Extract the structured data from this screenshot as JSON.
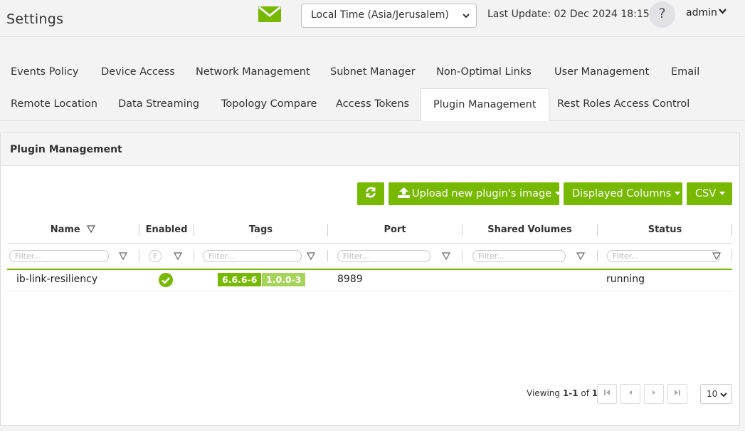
{
  "header": {
    "title": "Settings",
    "timezone_select": "Local Time (Asia/Jerusalem)",
    "last_update": "Last Update: 02 Dec 2024 18:15",
    "help_label": "?",
    "user": "admin",
    "icons": [
      "mail-icon",
      "chevron-down-icon",
      "help-icon"
    ]
  },
  "tabs": {
    "row1": [
      "Events Policy",
      "Device Access",
      "Network Management",
      "Subnet Manager",
      "Non-Optimal Links",
      "User Management",
      "Email"
    ],
    "row2": [
      "Remote Location",
      "Data Streaming",
      "Topology Compare",
      "Access Tokens",
      "Plugin Management",
      "Rest Roles Access Control"
    ],
    "active": "Plugin Management"
  },
  "panel": {
    "title": "Plugin Management",
    "toolbar": {
      "upload_label": "Upload new plugin's image",
      "columns_label": "Displayed Columns",
      "csv_label": "CSV"
    },
    "columns": [
      "Name",
      "Enabled",
      "Tags",
      "Port",
      "Shared Volumes",
      "Status"
    ],
    "filter_placeholder": "Filter...",
    "enabled_filter_placeholder": "F",
    "rows": [
      {
        "name": "ib-link-resiliency",
        "enabled": true,
        "tags": [
          "6.6.6-6",
          "1.0.0-3"
        ],
        "port": "8989",
        "shared_volumes": "",
        "status": "running"
      }
    ],
    "pager": {
      "viewing_prefix": "Viewing ",
      "range": "1-1",
      "of_label": " of ",
      "total": "1",
      "page_size": "10"
    }
  },
  "colors": {
    "accent": "#76b900",
    "tag_secondary": "#a6d35a"
  }
}
